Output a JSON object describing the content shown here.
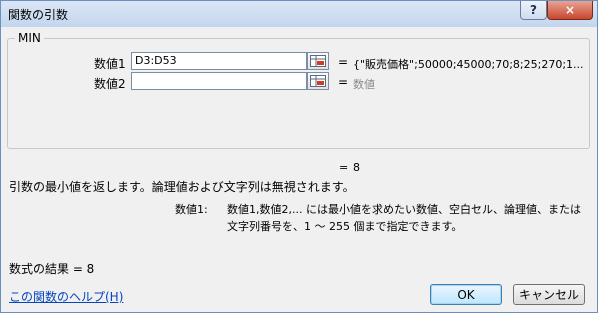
{
  "window": {
    "title": "関数の引数",
    "help_icon": "?",
    "close_icon": "×"
  },
  "function_name": "MIN",
  "arguments": [
    {
      "label": "数値1",
      "input_value": "D3:D53",
      "equals": "=",
      "value_text": "{\"販売価格\";50000;45000;70;8;25;270;1..."
    },
    {
      "label": "数値2",
      "input_value": "",
      "equals": "=",
      "value_text": "数値"
    }
  ],
  "result": {
    "equals": "=",
    "value": "8"
  },
  "description": "引数の最小値を返します。論理値および文字列は無視されます。",
  "argument_help": {
    "name": "数値1:",
    "text": "数値1,数値2,... には最小値を求めたい数値、空白セル、論理値、または文字列番号を、1 ～ 255 個まで指定できます。"
  },
  "formula_result": "数式の結果 =  8",
  "help_link": "この関数のヘルプ(H)",
  "buttons": {
    "ok": "OK",
    "cancel": "キャンセル"
  }
}
